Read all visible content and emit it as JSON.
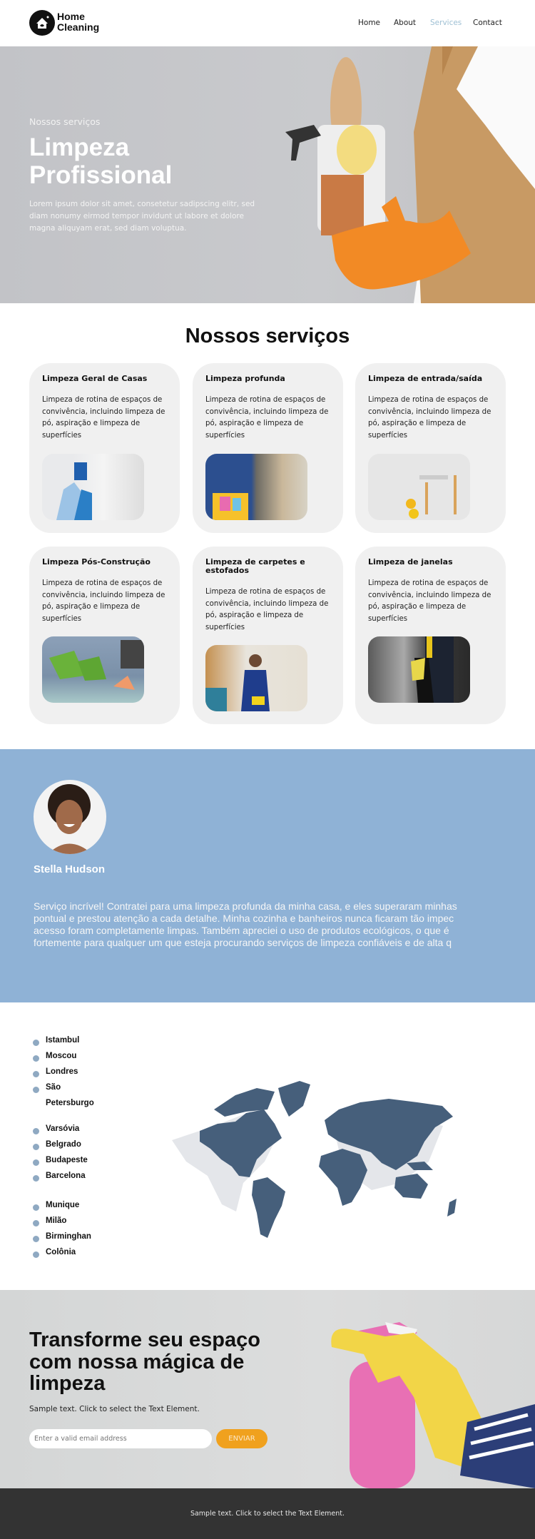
{
  "header": {
    "logo": "Home Cleaning",
    "logo_line1": "Home",
    "logo_line2": "Cleaning",
    "nav": [
      {
        "label": "Home"
      },
      {
        "label": "About"
      },
      {
        "label": "Services",
        "active": true
      },
      {
        "label": "Contact"
      }
    ],
    "active_color": "#9fc0d4"
  },
  "hero": {
    "subtitle": "Nossos serviços",
    "title_line1": "Limpeza",
    "title_line2": "Profissional",
    "text": "Lorem ipsum dolor sit amet, consetetur sadipscing elitr, sed diam nonumy eirmod tempor invidunt ut labore et dolore magna aliquyam erat, sed diam voluptua."
  },
  "services": {
    "title": "Nossos serviços",
    "cards": [
      {
        "title": "Limpeza Geral de Casas",
        "text": "Limpeza de rotina de espaços de convivência, incluindo limpeza de pó, aspiração e limpeza de superfícies"
      },
      {
        "title": "Limpeza profunda",
        "text": "Limpeza de rotina de espaços de convivência, incluindo limpeza de pó, aspiração e limpeza de superfícies"
      },
      {
        "title": "Limpeza de entrada/saída",
        "text": "Limpeza de rotina de espaços de convivência, incluindo limpeza de pó, aspiração e limpeza de superfícies"
      },
      {
        "title": "Limpeza Pós-Construção",
        "text": "Limpeza de rotina de espaços de convivência, incluindo limpeza de pó, aspiração e limpeza de superfícies"
      },
      {
        "title": "Limpeza de carpetes e estofados",
        "text": "Limpeza de rotina de espaços de convivência, incluindo limpeza de pó, aspiração e limpeza de superfícies"
      },
      {
        "title": "Limpeza de janelas",
        "text": "Limpeza de rotina de espaços de convivência, incluindo limpeza de pó, aspiração e limpeza de superfícies"
      }
    ]
  },
  "testimonial": {
    "name": "Stella Hudson",
    "lines": [
      "Serviço incrível! Contratei para uma limpeza profunda da minha casa, e eles superaram minhas",
      "pontual e prestou atenção a cada detalhe. Minha cozinha e banheiros nunca ficaram tão impec",
      "acesso foram completamente limpas. Também apreciei o uso de produtos ecológicos, o que é",
      "fortemente para qualquer um que esteja procurando serviços de limpeza confiáveis e de alta q"
    ],
    "bg_color": "#8fb2d6"
  },
  "locations": {
    "cities": [
      "Istambul",
      "Moscou",
      "Londres",
      "São Petersburgo",
      "Varsóvia",
      "Belgrado",
      "Budapeste",
      "Barcelona",
      "Munique",
      "Milão",
      "Birminghan",
      "Colônia"
    ],
    "map_color": "#465f7b"
  },
  "cta": {
    "title": "Transforme seu espaço com nossa mágica de limpeza",
    "text": "Sample text. Click to select the Text Element.",
    "email_placeholder": "Enter a valid email address",
    "button": "ENVIAR",
    "button_color": "#f0a11e"
  },
  "footer": {
    "text": "Sample text. Click to select the Text Element."
  }
}
